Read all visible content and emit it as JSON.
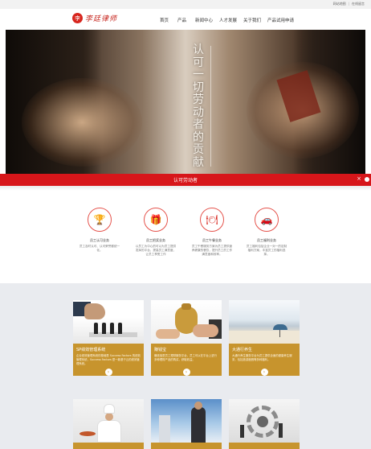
{
  "topbar": {
    "links": [
      "网站地图",
      "在线留言"
    ]
  },
  "header": {
    "logo_char": "李",
    "logo_text": "李廷律师",
    "nav": [
      "首页",
      "产品",
      "新闻中心",
      "人才发展",
      "关于我们",
      "产品试用申请"
    ]
  },
  "hero": {
    "vertical_text": "认可一切劳动者的贡献"
  },
  "ribbon": {
    "label": "认可劳动者",
    "close": "×"
  },
  "features": [
    {
      "icon": "trophy-icon",
      "glyph": "🏆",
      "title": "员工认可业务",
      "desc": "员工及时认可、认可荣誉都统一化。"
    },
    {
      "icon": "gift-icon",
      "glyph": "🎁",
      "title": "员工把奖业务",
      "desc": "以员工为中心的可以为员工提供发挥的平台，提高员工满意度，让员工享受工作"
    },
    {
      "icon": "dining-icon",
      "glyph": "🍽",
      "title": "员工午餐业务",
      "desc": "员工午餐服务方案为员工提供营养健康的餐饮，提升员工的工作满意度和效率。"
    },
    {
      "icon": "car-icon",
      "glyph": "🚗",
      "title": "员工福利业务",
      "desc": "员工福利包括企业一对一的定制福利方案，丰富员工的福利选择。"
    }
  ],
  "cards": [
    {
      "img": "chess",
      "title": "SP绩效管理系统",
      "desc": "企业绩效管理系统的基础是 Success Factors 的绩效管理系统，Success Factors 是一款基于云的绩效管理系统。",
      "more": "›"
    },
    {
      "img": "money",
      "title": "赚钱宝",
      "desc": "赚钱宝是员工理财服务平台，员工可以在平台上进行多种理财产品的购买，获取收益。",
      "more": "›"
    },
    {
      "img": "beach",
      "title": "大通行养生",
      "desc": "大通行养生服务平台为员工提供全面的健康养生服务，包括旅游度假等多种福利。",
      "more": "›"
    },
    {
      "img": "chef",
      "title": "",
      "desc": "",
      "more": ""
    },
    {
      "img": "sky",
      "title": "",
      "desc": "",
      "more": ""
    },
    {
      "img": "gear",
      "title": "",
      "desc": "",
      "more": ""
    }
  ],
  "colors": {
    "brand_red": "#d7161a",
    "card_gold": "#c7942d",
    "grey_bg": "#e9ebef"
  }
}
